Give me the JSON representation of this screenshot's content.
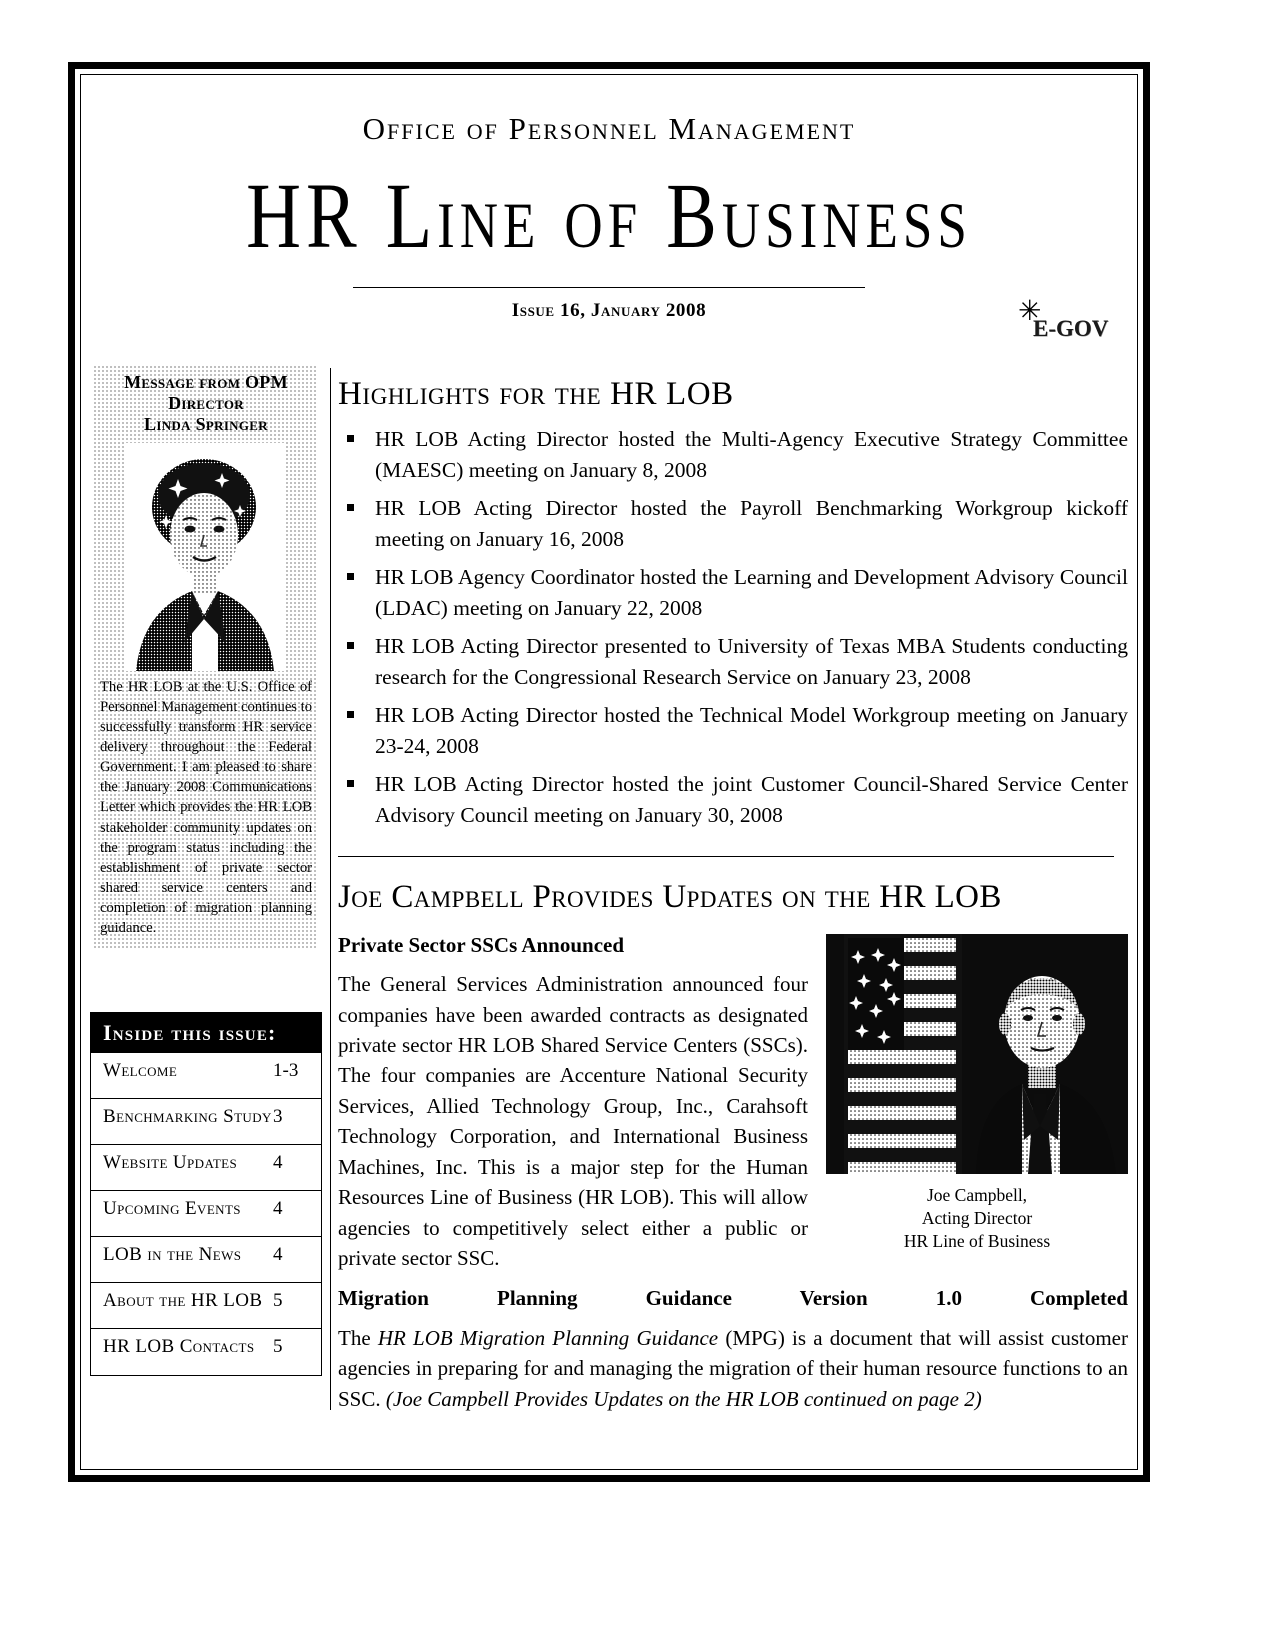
{
  "masthead": {
    "org_name": "Office of Personnel Management",
    "title": "HR Line of Business",
    "issue_line": "Issue 16, January 2008",
    "logo_text": "E-GOV",
    "logo_star_icon": "star-icon"
  },
  "sidebar": {
    "message_title_line1": "Message from OPM",
    "message_title_line2": "Director",
    "message_title_line3": "Linda Springer",
    "photo_alt": "Linda Springer portrait",
    "message_body": "The HR LOB at the U.S. Office of Personnel Management continues to successfully transform HR service delivery throughout the Federal Government. I am pleased to share the January 2008 Communications Letter which provides the HR LOB stakeholder community updates on the program status including the establishment of private sector shared service centers and completion of migration planning guidance.",
    "toc": {
      "header": "Inside this issue:",
      "rows": [
        {
          "label": "Welcome",
          "page": "1-3"
        },
        {
          "label": "Benchmarking Study",
          "page": "3"
        },
        {
          "label": "Website Updates",
          "page": "4"
        },
        {
          "label": "Upcoming Events",
          "page": "4"
        },
        {
          "label": "LOB in the News",
          "page": "4"
        },
        {
          "label": "About the HR LOB",
          "page": "5"
        },
        {
          "label": "HR LOB Contacts",
          "page": "5"
        }
      ]
    }
  },
  "main": {
    "highlights_heading": "Highlights for the HR LOB",
    "highlights": [
      "HR LOB Acting Director hosted the Multi-Agency Executive Strategy Committee (MAESC) meeting on January 8, 2008",
      "HR LOB Acting Director hosted the Payroll Benchmarking Workgroup kickoff meeting on January 16, 2008",
      "HR LOB Agency Coordinator hosted the Learning and Development Advisory Council (LDAC) meeting on January 22, 2008",
      "HR LOB Acting Director presented to University of Texas MBA Students conducting research for the Congressional Research Service on January 23, 2008",
      "HR LOB Acting Director hosted the Technical Model Workgroup meeting on January 23-24, 2008",
      "HR LOB Acting Director hosted the joint Customer Council-Shared Service Center Advisory Council meeting on January 30, 2008"
    ],
    "joe_heading": "Joe Campbell Provides Updates on the HR LOB",
    "subhead_1": "Private Sector SSCs Announced",
    "paragraph_1": "The General Services Administration announced four companies have been awarded contracts as designated private sector HR LOB Shared Service Centers (SSCs). The four companies are Accenture National Security Services, Allied Technology Group, Inc., Carahsoft Technology Corporation, and International Business Machines, Inc. This is a major step for the Human Resources Line of Business (HR LOB). This will allow agencies to competitively select either a public or private sector SSC.",
    "subhead_2": "Migration Planning Guidance Version 1.0 Completed",
    "paragraph_2_pre": "The ",
    "paragraph_2_italic": "HR LOB Migration Planning Guidance",
    "paragraph_2_mid": " (MPG) is a document that will assist customer agencies in preparing for and managing the migration of their human resource functions to an SSC. ",
    "paragraph_2_continued": "(Joe Campbell Provides Updates on the HR LOB continued on page 2)",
    "photo_caption_line1": "Joe Campbell,",
    "photo_caption_line2": "Acting Director",
    "photo_caption_line3": "HR Line of Business",
    "photo_alt": "Joe Campbell portrait with US flag"
  }
}
